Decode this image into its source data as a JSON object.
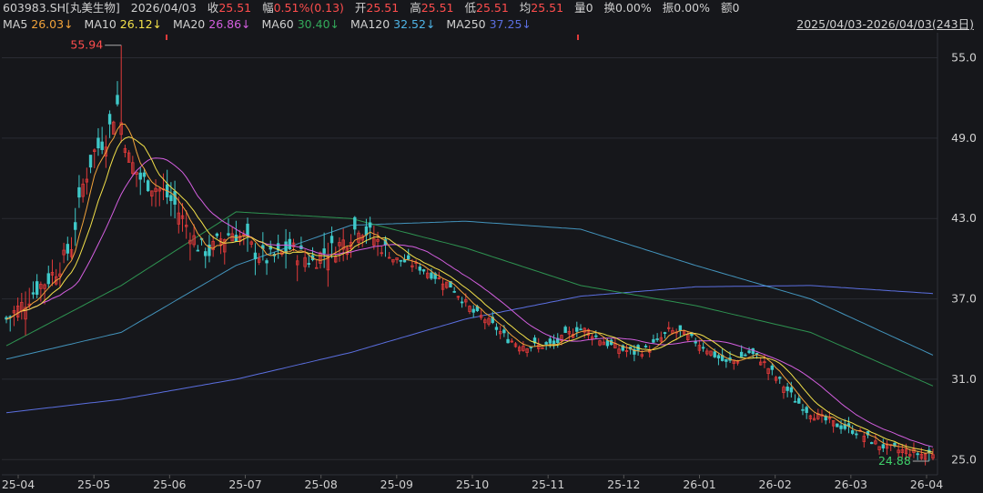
{
  "quote": {
    "symbol": "603983.SH[丸美生物]",
    "date": "2026/04/03",
    "close_label": "收",
    "close": "25.51",
    "change_label": "幅",
    "change": "0.51%(0.13)",
    "open_label": "开",
    "open": "25.51",
    "high_label": "高",
    "high": "25.51",
    "low_label": "低",
    "low": "25.51",
    "avg_label": "均",
    "avg": "25.51",
    "vol_label": "量",
    "vol": "0",
    "turnover_label": "换",
    "turnover": "0.00%",
    "amp_label": "振",
    "amp": "0.00%",
    "amount_label": "额",
    "amount": "0"
  },
  "ma": [
    {
      "label": "MA5",
      "value": "26.03↓",
      "color": "#f2a33a"
    },
    {
      "label": "MA10",
      "value": "26.12↓",
      "color": "#f3e14a"
    },
    {
      "label": "MA20",
      "value": "26.86↓",
      "color": "#d45fe0"
    },
    {
      "label": "MA60",
      "value": "30.40↓",
      "color": "#33a95a"
    },
    {
      "label": "MA120",
      "value": "32.52↓",
      "color": "#4fb4e6"
    },
    {
      "label": "MA250",
      "value": "37.25↓",
      "color": "#5b6fe0"
    }
  ],
  "range_label": "2025/04/03-2026/04/03(243日)",
  "colors": {
    "up": "#e03a3a",
    "down": "#3fc9c9",
    "grid": "#2a2c33",
    "axis_text": "#d0d0d0",
    "max_label": "#ff4d4d",
    "min_label": "#3fd06a"
  },
  "chart_data": {
    "type": "candlestick",
    "ylim": [
      24.0,
      56.6
    ],
    "yticks": [
      "55.0",
      "49.0",
      "43.0",
      "37.0",
      "31.0",
      "25.0"
    ],
    "ytick_values": [
      55,
      49,
      43,
      37,
      31,
      25
    ],
    "xticks": [
      "25-04",
      "25-05",
      "25-06",
      "25-07",
      "25-08",
      "25-09",
      "25-10",
      "25-11",
      "25-12",
      "26-01",
      "26-02",
      "26-03",
      "26-04"
    ],
    "max_label": "55.94",
    "min_label": "24.88",
    "anchors_close": [
      [
        0,
        35.5
      ],
      [
        4,
        36.5
      ],
      [
        8,
        37.8
      ],
      [
        11,
        38.5
      ],
      [
        14,
        39.5
      ],
      [
        17,
        41.0
      ],
      [
        20,
        45.5
      ],
      [
        23,
        48.0
      ],
      [
        26,
        49.0
      ],
      [
        29,
        51.5
      ],
      [
        32,
        47.5
      ],
      [
        35,
        46.0
      ],
      [
        38,
        45.5
      ],
      [
        41,
        45.0
      ],
      [
        44,
        44.0
      ],
      [
        47,
        42.5
      ],
      [
        50,
        41.0
      ],
      [
        53,
        40.5
      ],
      [
        56,
        41.5
      ],
      [
        59,
        42.0
      ],
      [
        62,
        41.5
      ],
      [
        65,
        40.5
      ],
      [
        68,
        40.0
      ],
      [
        71,
        40.2
      ],
      [
        74,
        40.8
      ],
      [
        77,
        40.3
      ],
      [
        80,
        39.8
      ],
      [
        83,
        40.5
      ],
      [
        86,
        40.8
      ],
      [
        89,
        41.5
      ],
      [
        92,
        42.5
      ],
      [
        95,
        41.8
      ],
      [
        98,
        41.0
      ],
      [
        101,
        40.0
      ],
      [
        104,
        39.8
      ],
      [
        107,
        39.5
      ],
      [
        110,
        39.0
      ],
      [
        113,
        38.5
      ],
      [
        116,
        38.0
      ],
      [
        119,
        37.0
      ],
      [
        122,
        36.0
      ],
      [
        125,
        35.5
      ],
      [
        128,
        34.8
      ],
      [
        131,
        34.0
      ],
      [
        134,
        33.6
      ],
      [
        137,
        33.5
      ],
      [
        140,
        33.5
      ],
      [
        143,
        33.6
      ],
      [
        146,
        34.2
      ],
      [
        149,
        34.8
      ],
      [
        152,
        34.6
      ],
      [
        155,
        34.0
      ],
      [
        158,
        33.5
      ],
      [
        161,
        33.2
      ],
      [
        164,
        33.0
      ],
      [
        167,
        33.2
      ],
      [
        170,
        33.8
      ],
      [
        173,
        34.6
      ],
      [
        176,
        34.5
      ],
      [
        179,
        34.0
      ],
      [
        182,
        33.5
      ],
      [
        185,
        32.8
      ],
      [
        188,
        32.2
      ],
      [
        191,
        32.5
      ],
      [
        194,
        33.0
      ],
      [
        197,
        32.5
      ],
      [
        200,
        31.5
      ],
      [
        203,
        30.5
      ],
      [
        206,
        29.5
      ],
      [
        209,
        28.7
      ],
      [
        212,
        28.2
      ],
      [
        215,
        27.8
      ],
      [
        218,
        27.5
      ],
      [
        221,
        27.2
      ],
      [
        224,
        26.8
      ],
      [
        227,
        26.2
      ],
      [
        230,
        25.9
      ],
      [
        233,
        25.7
      ],
      [
        236,
        25.6
      ],
      [
        239,
        25.4
      ],
      [
        242,
        25.51
      ]
    ],
    "series": [
      {
        "name": "MA5",
        "values": []
      },
      {
        "name": "MA10",
        "values": []
      },
      {
        "name": "MA20",
        "values": []
      },
      {
        "name": "MA60",
        "values": []
      },
      {
        "name": "MA120",
        "values": []
      },
      {
        "name": "MA250",
        "values": []
      }
    ],
    "ma250_curve": [
      [
        0,
        28.5
      ],
      [
        30,
        29.5
      ],
      [
        60,
        31.0
      ],
      [
        90,
        33.0
      ],
      [
        120,
        35.5
      ],
      [
        150,
        37.2
      ],
      [
        180,
        37.9
      ],
      [
        210,
        38.0
      ],
      [
        242,
        37.4
      ]
    ],
    "ma120_curve": [
      [
        0,
        32.5
      ],
      [
        30,
        34.5
      ],
      [
        60,
        39.5
      ],
      [
        90,
        42.5
      ],
      [
        120,
        42.8
      ],
      [
        150,
        42.2
      ],
      [
        180,
        39.5
      ],
      [
        210,
        37.0
      ],
      [
        242,
        32.8
      ]
    ],
    "ma60_curve": [
      [
        0,
        33.5
      ],
      [
        30,
        38.0
      ],
      [
        60,
        43.5
      ],
      [
        90,
        43.0
      ],
      [
        120,
        40.8
      ],
      [
        150,
        38.0
      ],
      [
        180,
        36.5
      ],
      [
        210,
        34.5
      ],
      [
        242,
        30.5
      ]
    ]
  }
}
